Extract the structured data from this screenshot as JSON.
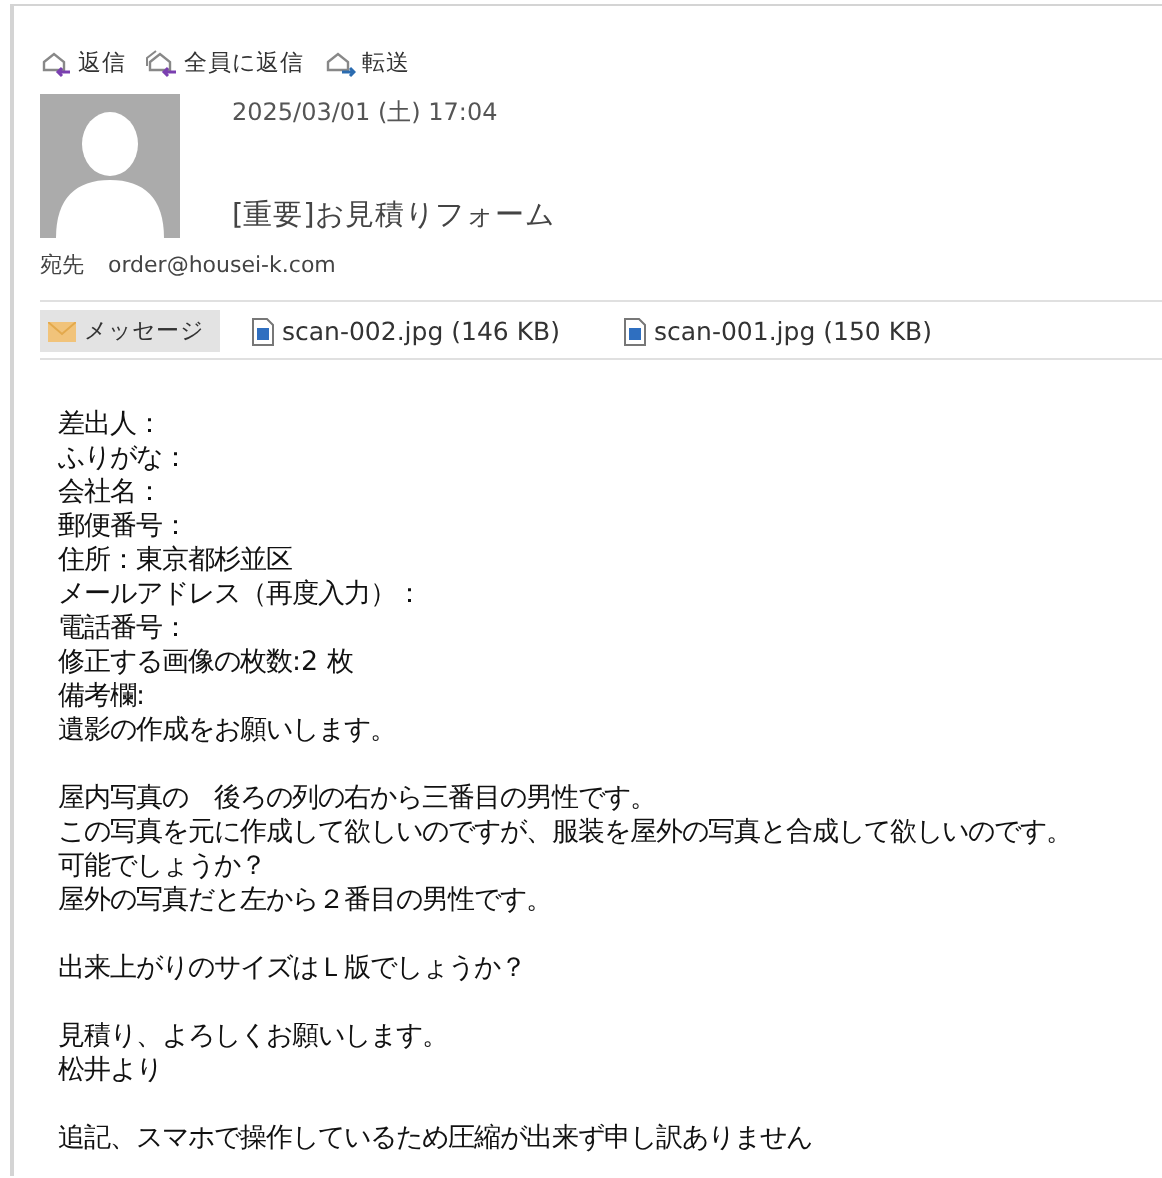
{
  "toolbar": [
    {
      "kind": "reply",
      "label": "返信"
    },
    {
      "kind": "reply_all",
      "label": "全員に返信"
    },
    {
      "kind": "forward",
      "label": "転送"
    }
  ],
  "header": {
    "date": "2025/03/01 (土) 17:04",
    "subject": "[重要]お見積りフォーム",
    "to_label": "宛先",
    "to": "order@housei-k.com"
  },
  "attachments": [
    {
      "kind": "message",
      "label": "メッセージ",
      "selected": true
    },
    {
      "kind": "file",
      "label": "scan-002.jpg (146 KB)",
      "selected": false
    },
    {
      "kind": "file",
      "label": "scan-001.jpg (150 KB)",
      "selected": false
    }
  ],
  "body": [
    [
      "差出人：",
      "ふりがな：",
      "会社名：",
      "郵便番号：",
      "住所：東京都杉並区",
      "メールアドレス（再度入力）：",
      "電話番号：",
      "修正する画像の枚数:2 枚",
      "備考欄:",
      "遺影の作成をお願いします。"
    ],
    [
      "屋内写真の　後ろの列の右から三番目の男性です。",
      "この写真を元に作成して欲しいのですが、服装を屋外の写真と合成して欲しいのです。",
      "可能でしょうか？",
      "屋外の写真だと左から２番目の男性です。"
    ],
    [
      "出来上がりのサイズはＬ版でしょうか？"
    ],
    [
      "見積り、よろしくお願いします。",
      "松井より"
    ],
    [
      "追記、スマホで操作しているため圧縮が出来ず申し訳ありません"
    ]
  ]
}
